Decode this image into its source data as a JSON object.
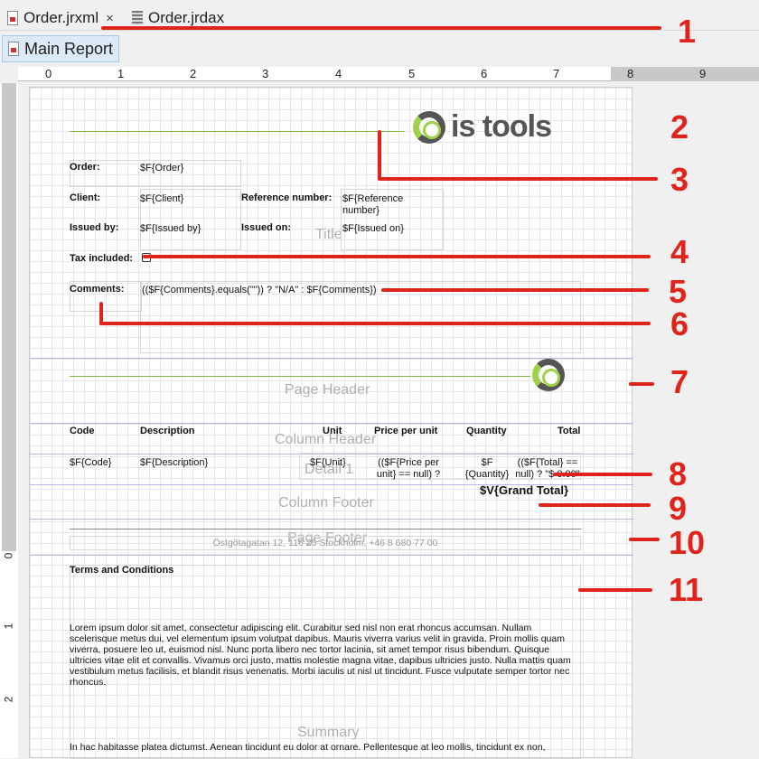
{
  "tabs": [
    {
      "label": "Order.jrxml",
      "close": "×"
    },
    {
      "label": "Order.jrdax"
    }
  ],
  "main_report_label": "Main Report",
  "ruler_h": [
    "0",
    "1",
    "2",
    "3",
    "4",
    "5",
    "6",
    "7",
    "8",
    "9"
  ],
  "ruler_v": [
    "0",
    "1",
    "2"
  ],
  "bands": {
    "title": "Title",
    "page_header": "Page Header",
    "column_header": "Column Header",
    "detail": "Detail 1",
    "column_footer": "Column Footer",
    "page_footer": "Page Footer",
    "summary": "Summary"
  },
  "logo": {
    "text": "is tools"
  },
  "title_fields": {
    "order_label": "Order:",
    "order_value": "$F{Order}",
    "client_label": "Client:",
    "client_value": "$F{Client}",
    "refnum_label": "Reference number:",
    "refnum_value": "$F{Reference number}",
    "issued_by_label": "Issued by:",
    "issued_by_value": "$F{Issued by}",
    "issued_on_label": "Issued on:",
    "issued_on_value": "$F{Issued on}",
    "tax_label": "Tax included:",
    "comments_label": "Comments:",
    "comments_value": "(($F{Comments}.equals(\"\")) ? \"N/A\" : $F{Comments})"
  },
  "columns": {
    "code": "Code",
    "description": "Description",
    "unit": "Unit",
    "price": "Price per unit",
    "quantity": "Quantity",
    "total": "Total"
  },
  "detail": {
    "code": "$F{Code}",
    "description": "$F{Description}",
    "unit": "$F{Unit}",
    "price": "(($F{Price per unit} == null) ?",
    "quantity": "$F {Quantity}",
    "total": "(($F{Total} == null) ? \"$ 0.00\""
  },
  "grand_total": "$V{Grand Total}",
  "footer_address": "Östgötagatan 12, 116 25 Stockholm, +46 8 680 77 00",
  "summary": {
    "terms_title": "Terms and Conditions",
    "para1": "Lorem ipsum dolor sit amet, consectetur adipiscing elit. Curabitur sed nisl non erat rhoncus accumsan. Nullam scelerisque metus dui, vel elementum ipsum volutpat dapibus. Mauris viverra varius velit in gravida. Proin mollis quam viverra, posuere leo ut, euismod nisl. Nunc porta libero nec tortor lacinia, sit amet tempor risus bibendum. Quisque ultricies vitae elit et convallis. Vivamus orci justo, mattis molestie magna vitae, dapibus ultricies justo. Nulla mattis quam vestibulum metus facilisis, et blandit risus venenatis. Morbi iaculis ut nisl ut tincidunt. Fusce vulputate semper tortor nec rhoncus.",
    "para2": "In hac habitasse platea dictumst. Aenean tincidunt eu dolor at ornare. Pellentesque at leo mollis, tincidunt ex non,"
  },
  "annotations": [
    "1",
    "2",
    "3",
    "4",
    "5",
    "6",
    "7",
    "8",
    "9",
    "10",
    "11"
  ],
  "colors": {
    "annotation": "#e0241c",
    "accent_line": "#7dbb40"
  }
}
